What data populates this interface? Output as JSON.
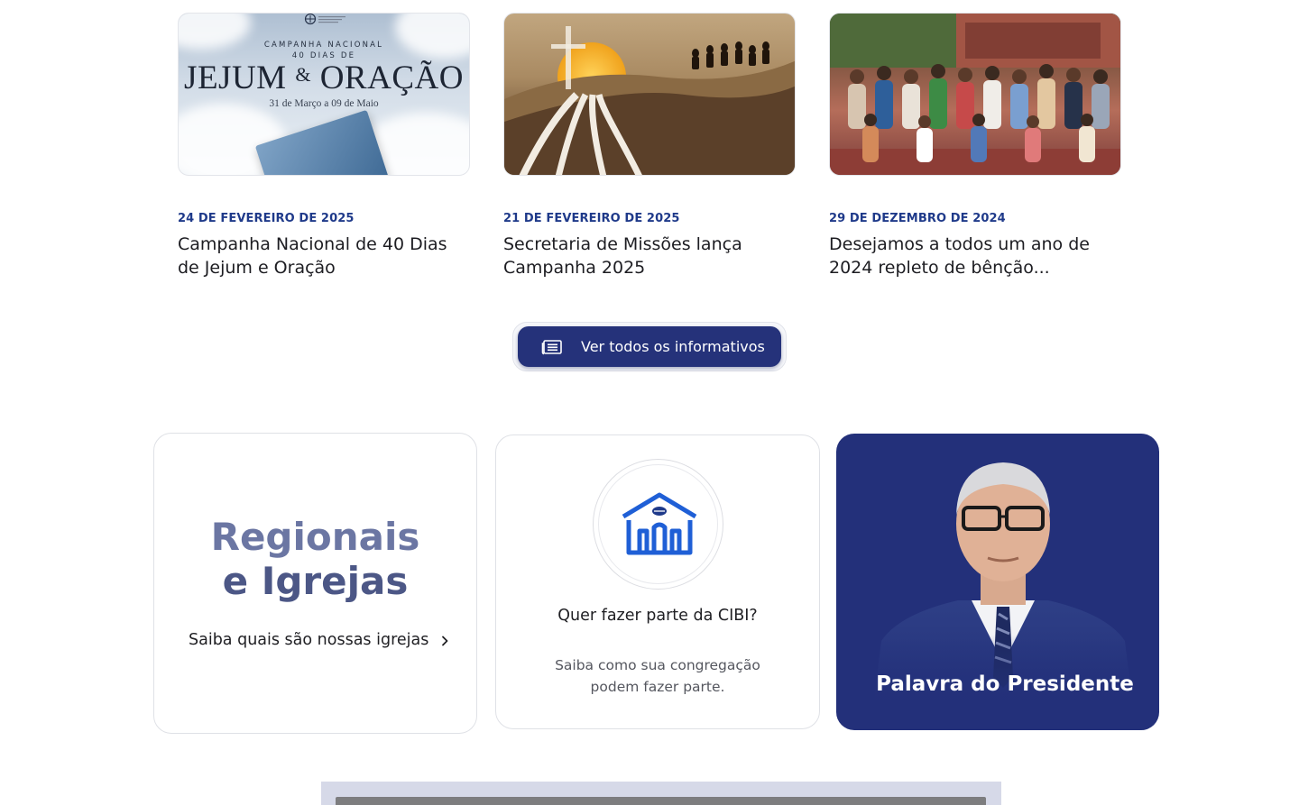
{
  "news": [
    {
      "date": "24 DE FEVEREIRO DE 2025",
      "title": "Campanha Nacional de 40 Dias de Jejum e Oração",
      "thumb": {
        "line1": "CAMPANHA NACIONAL",
        "line2": "40 DIAS DE",
        "headline_a": "JEJUM",
        "amp": "&",
        "headline_b": "ORAÇÃO",
        "dates": "31 de Março a 09 de Maio"
      }
    },
    {
      "date": "21 DE FEVEREIRO DE 2025",
      "title": "Secretaria de Missões lança Campanha 2025"
    },
    {
      "date": "29 DE DEZEMBRO DE 2024",
      "title": "Desejamos a todos um ano de 2024 repleto de bênção..."
    }
  ],
  "more_button": {
    "label": "Ver todos os informativos",
    "icon": "newspaper-icon"
  },
  "regionais": {
    "heading_line1": "Regionais",
    "heading_line2": "e Igrejas",
    "link": "Saiba quais são nossas igrejas"
  },
  "join": {
    "icon": "church-icon",
    "title": "Quer fazer parte da CIBI?",
    "desc_line1": "Saiba como sua congregação",
    "desc_line2": "podem fazer parte."
  },
  "president": {
    "label": "Palavra do Presidente"
  },
  "colors": {
    "brand_navy": "#25327a",
    "date_blue": "#1f3a8a",
    "card_navy": "#23307a",
    "church_blue": "#1f5fd6"
  }
}
